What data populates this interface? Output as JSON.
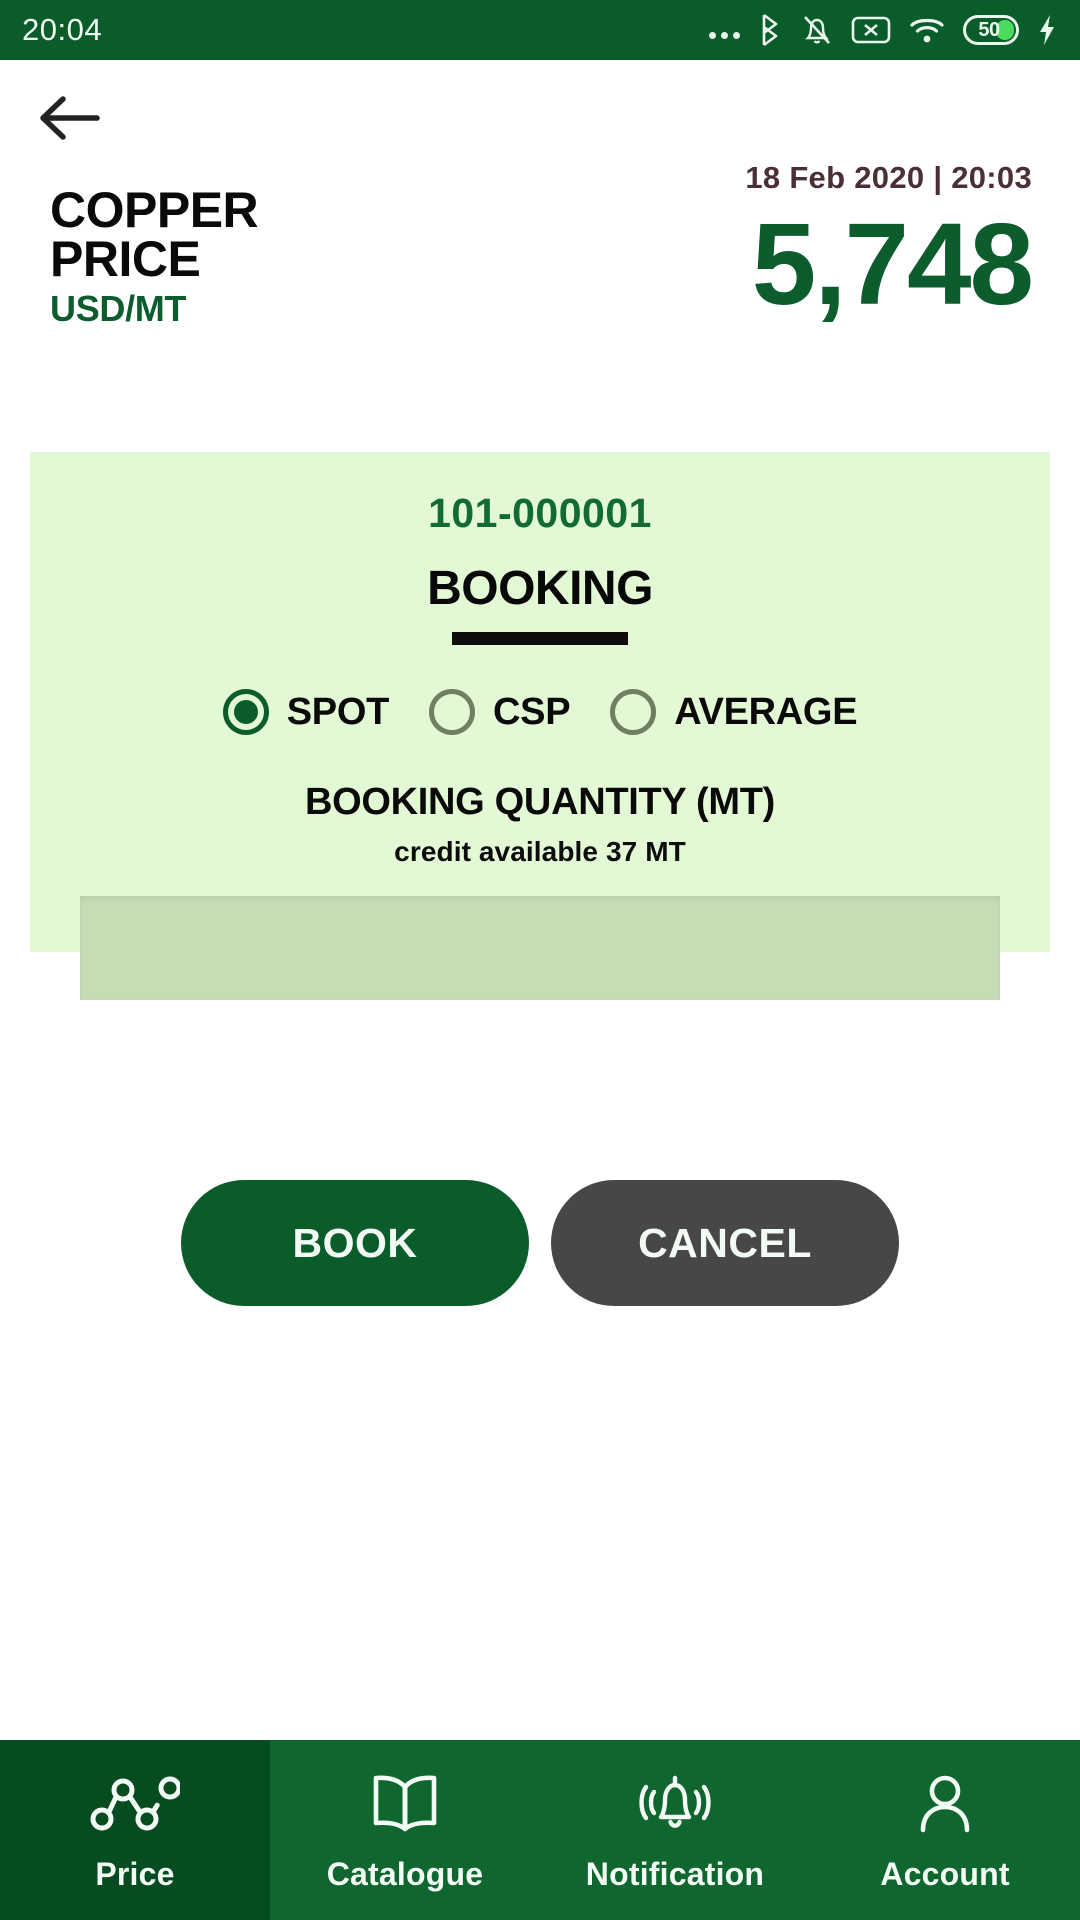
{
  "statusbar": {
    "time": "20:04",
    "icons": [
      "overflow-dots-icon",
      "bluetooth-icon",
      "bell-muted-icon",
      "sim-x-icon",
      "wifi-icon",
      "battery-icon",
      "charging-bolt-icon"
    ],
    "battery_level": "50"
  },
  "header": {
    "back_icon": "back-arrow-icon",
    "datetime": "18 Feb 2020 | 20:03",
    "title": "COPPER PRICE",
    "unit": "USD/MT",
    "price": "5,748",
    "accent_green": "#0c5c2e",
    "datetime_color": "#4a3035"
  },
  "card": {
    "reference": "101-000001",
    "heading": "BOOKING",
    "background": "#e3f8d4",
    "price_type": {
      "selected": "SPOT",
      "options": [
        {
          "label": "SPOT",
          "selected": true
        },
        {
          "label": "CSP",
          "selected": false
        },
        {
          "label": "AVERAGE",
          "selected": false
        }
      ]
    },
    "quantity": {
      "label": "BOOKING QUANTITY (MT)",
      "credit_note": "credit available 37 MT",
      "value": "",
      "placeholder": ""
    }
  },
  "actions": {
    "book_label": "BOOK",
    "cancel_label": "CANCEL",
    "book_color": "#0b5c2b",
    "cancel_color": "#474747"
  },
  "bottomnav": {
    "background": "#10662f",
    "active_background": "#074c20",
    "items": [
      {
        "label": "Price",
        "icon": "line-chart-nodes-icon",
        "active": true
      },
      {
        "label": "Catalogue",
        "icon": "open-book-icon",
        "active": false
      },
      {
        "label": "Notification",
        "icon": "bell-ringing-icon",
        "active": false
      },
      {
        "label": "Account",
        "icon": "person-icon",
        "active": false
      }
    ]
  }
}
